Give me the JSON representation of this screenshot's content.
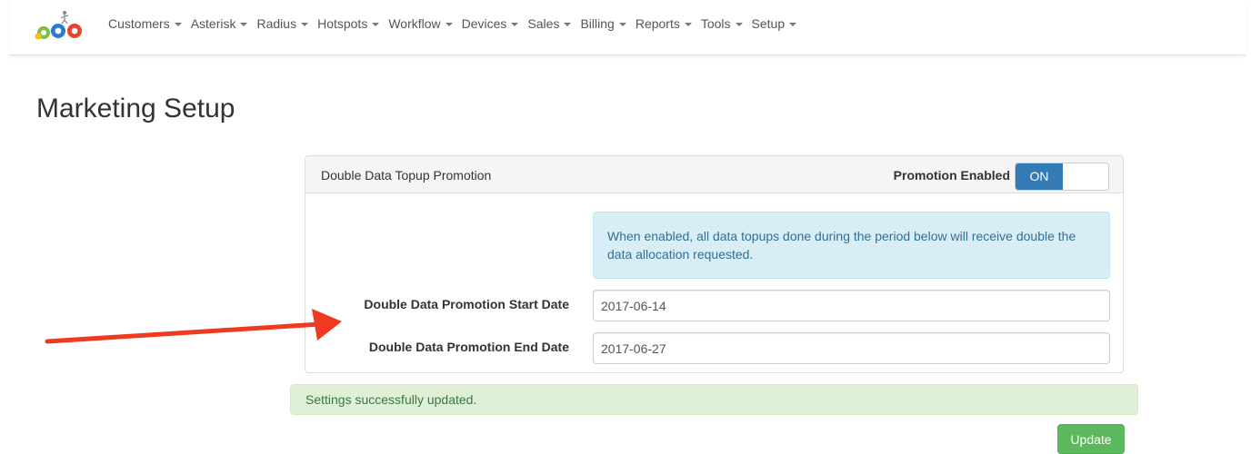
{
  "nav": {
    "items": [
      {
        "label": "Customers"
      },
      {
        "label": "Asterisk"
      },
      {
        "label": "Radius"
      },
      {
        "label": "Hotspots"
      },
      {
        "label": "Workflow"
      },
      {
        "label": "Devices"
      },
      {
        "label": "Sales"
      },
      {
        "label": "Billing"
      },
      {
        "label": "Reports"
      },
      {
        "label": "Tools"
      },
      {
        "label": "Setup"
      }
    ]
  },
  "page": {
    "title": "Marketing Setup"
  },
  "panel": {
    "title": "Double Data Topup Promotion",
    "toggle_label": "Promotion Enabled",
    "toggle_state": "ON",
    "info_text": "When enabled, all data topups done during the period below will receive double the data allocation requested.",
    "start_label": "Double Data Promotion Start Date",
    "start_value": "2017-06-14",
    "end_label": "Double Data Promotion End Date",
    "end_value": "2017-06-27"
  },
  "alert": {
    "text": "Settings successfully updated."
  },
  "actions": {
    "update_label": "Update"
  },
  "colors": {
    "primary": "#337ab7",
    "success": "#5cb85c",
    "info_bg": "#d9edf7",
    "alert_success_bg": "#dff0d8",
    "annotation_arrow": "#f03a20"
  }
}
